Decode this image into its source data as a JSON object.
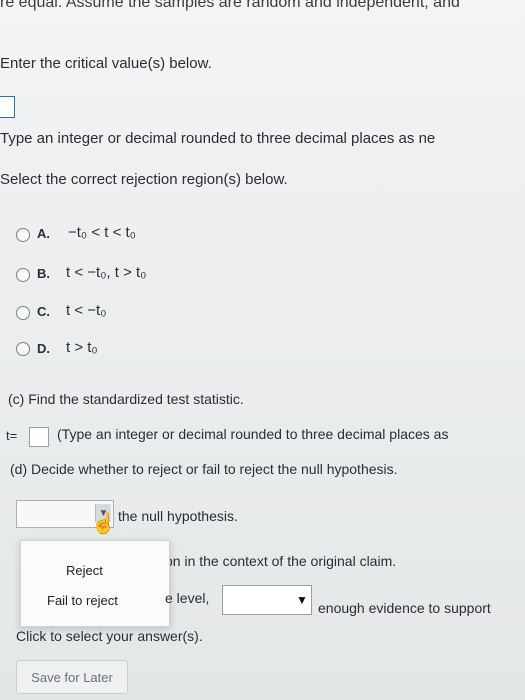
{
  "header": {
    "cut_text": "re equal. Assume the samples are random and independent, and"
  },
  "part_b": {
    "enter_critical": "Enter the critical value(s) below.",
    "type_hint": "Type an integer or decimal rounded to three decimal places as ne",
    "select_region": "Select the correct rejection region(s) below.",
    "options": [
      {
        "letter": "A.",
        "text": "−t₀ < t < t₀"
      },
      {
        "letter": "B.",
        "text": "t < −t₀, t > t₀"
      },
      {
        "letter": "C.",
        "text": "t < −t₀"
      },
      {
        "letter": "D.",
        "text": "t > t₀"
      }
    ]
  },
  "part_c": {
    "question": "(c) Find the standardized test statistic.",
    "t_label": "t=",
    "hint": "(Type an integer or decimal rounded to three decimal places as"
  },
  "part_d": {
    "question": "(d) Decide whether to reject or fail to reject the null hypothesis.",
    "null_hypothesis": "the null hypothesis.",
    "interpret_partial": "on in the context of the original claim.",
    "level_partial": "e level,",
    "enough_evidence": "enough evidence to support",
    "dropdown_options": [
      "Reject",
      "Fail to reject"
    ]
  },
  "footer": {
    "click_to_select": "Click to select your answer(s).",
    "save_for_later": "Save for Later"
  },
  "colors": {
    "accent_blue": "#2a6fb0",
    "text": "#2a2d33"
  }
}
